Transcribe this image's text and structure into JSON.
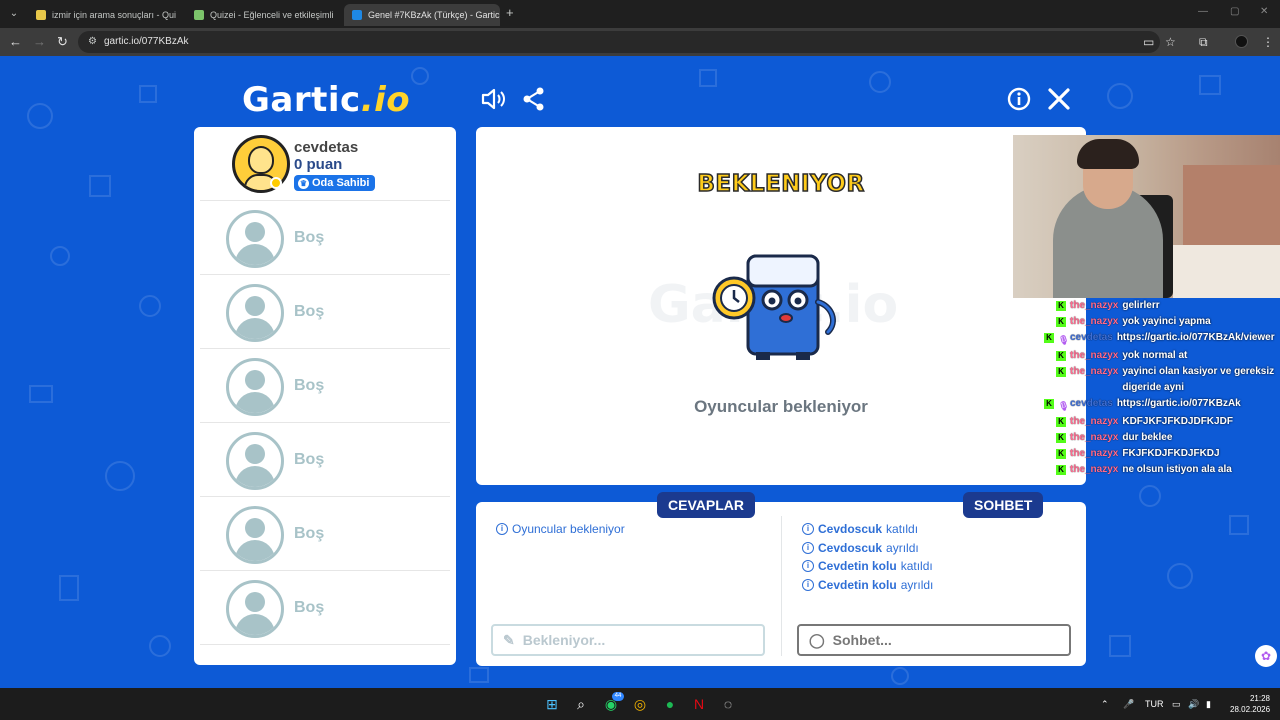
{
  "browser": {
    "tabs": [
      {
        "title": "izmir için arama sonuçları - Qui",
        "color": "#e8c84a"
      },
      {
        "title": "Quizei - Eğlenceli ve etkileşimli",
        "color": "#7cc46b"
      },
      {
        "title": "Genel #7KBzAk (Türkçe) - Gartic",
        "color": "#1e88e5"
      }
    ],
    "url": "gartic.io/077KBzAk"
  },
  "game": {
    "logo_main": "Gartic",
    "logo_suffix": ".io",
    "host": {
      "name": "cevdetas",
      "points": "0 puan",
      "badge": "Oda Sahibi"
    },
    "empty_slots": [
      "Boş",
      "Boş",
      "Boş",
      "Boş",
      "Boş",
      "Boş"
    ],
    "stage_title": "BEKLENIYOR",
    "stage_watermark": "Gartic.io",
    "stage_subtitle": "Oyuncular bekleniyor",
    "answers": {
      "tab_label": "CEVAPLAR",
      "messages": [
        "Oyuncular bekleniyor"
      ],
      "input_placeholder": "Bekleniyor..."
    },
    "chat": {
      "tab_label": "SOHBET",
      "messages": [
        {
          "user": "Cevdoscuk",
          "verb": "katıldı"
        },
        {
          "user": "Cevdoscuk",
          "verb": "ayrıldı"
        },
        {
          "user": "Cevdetin kolu",
          "verb": "katıldı"
        },
        {
          "user": "Cevdetin kolu",
          "verb": "ayrıldı"
        }
      ],
      "input_placeholder": "Sohbet..."
    }
  },
  "stream_chat": [
    {
      "user": "the_nazyx",
      "text": "gelirlerr",
      "mic": false,
      "blue": false
    },
    {
      "user": "the_nazyx",
      "text": "yok yayinci yapma",
      "mic": false,
      "blue": false
    },
    {
      "user": "cevdetas",
      "text": "https://gartic.io/077KBzAk/viewer",
      "mic": true,
      "blue": true
    },
    {
      "user": "the_nazyx",
      "text": "yok normal at",
      "mic": false,
      "blue": false
    },
    {
      "user": "the_nazyx",
      "text": "yayinci olan kasiyor ve gereksiz digeride ayni",
      "mic": false,
      "blue": false
    },
    {
      "user": "cevdetas",
      "text": "https://gartic.io/077KBzAk",
      "mic": true,
      "blue": true
    },
    {
      "user": "the_nazyx",
      "text": "KDFJKFJFKDJDFKJDF",
      "mic": false,
      "blue": false
    },
    {
      "user": "the_nazyx",
      "text": "dur beklee",
      "mic": false,
      "blue": false
    },
    {
      "user": "the_nazyx",
      "text": "FKJFKDJFKDJFKDJ",
      "mic": false,
      "blue": false
    },
    {
      "user": "the_nazyx",
      "text": "ne olsun istiyon ala ala",
      "mic": false,
      "blue": false
    }
  ],
  "taskbar": {
    "whatsapp_badge": "44",
    "language": "TUR",
    "time": "21:28",
    "date": "28.02.2026"
  }
}
